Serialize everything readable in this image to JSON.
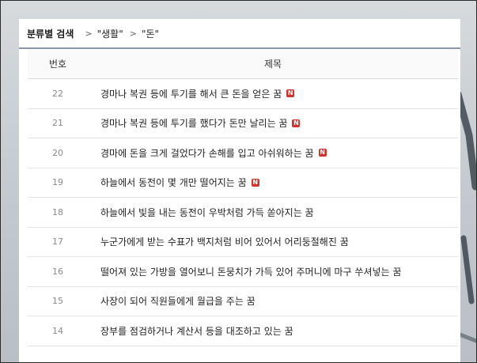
{
  "breadcrumb": {
    "root": "분류별 검색",
    "separator": ">",
    "segments": [
      "\"생활\"",
      "\"돈\""
    ]
  },
  "table": {
    "columns": [
      "번호",
      "제목"
    ],
    "new_badge": "N",
    "rows": [
      {
        "num": "22",
        "title": "경마나 복권 등에 투기를 해서 큰 돈을 얻은 꿈",
        "new": true
      },
      {
        "num": "21",
        "title": "경마나 복권 등에 투기를 했다가 돈만 날리는 꿈",
        "new": true
      },
      {
        "num": "20",
        "title": "경마에 돈을 크게 걸었다가 손해를 입고 아쉬워하는 꿈",
        "new": true
      },
      {
        "num": "19",
        "title": "하늘에서 동전이 몇 개만 떨어지는 꿈",
        "new": true
      },
      {
        "num": "18",
        "title": "하늘에서 빛을 내는 동전이 우박처럼 가득 쏟아지는 꿈",
        "new": false
      },
      {
        "num": "17",
        "title": "누군가에게 받는 수표가 백지처럼 비어 있어서 어리둥절해진 꿈",
        "new": false
      },
      {
        "num": "16",
        "title": "떨어져 있는 가방을 열어보니 돈뭉치가 가득 있어 주머니에 마구 쑤셔넣는 꿈",
        "new": false
      },
      {
        "num": "15",
        "title": "사장이 되어 직원들에게 월급을 주는 꿈",
        "new": false
      },
      {
        "num": "14",
        "title": "장부를 점검하거나 계산서 등을 대조하고 있는 꿈",
        "new": false
      }
    ]
  },
  "colors": {
    "badge": "#d0342c",
    "header_rule": "#8a96a6",
    "backdrop": "#c3c9ce"
  }
}
